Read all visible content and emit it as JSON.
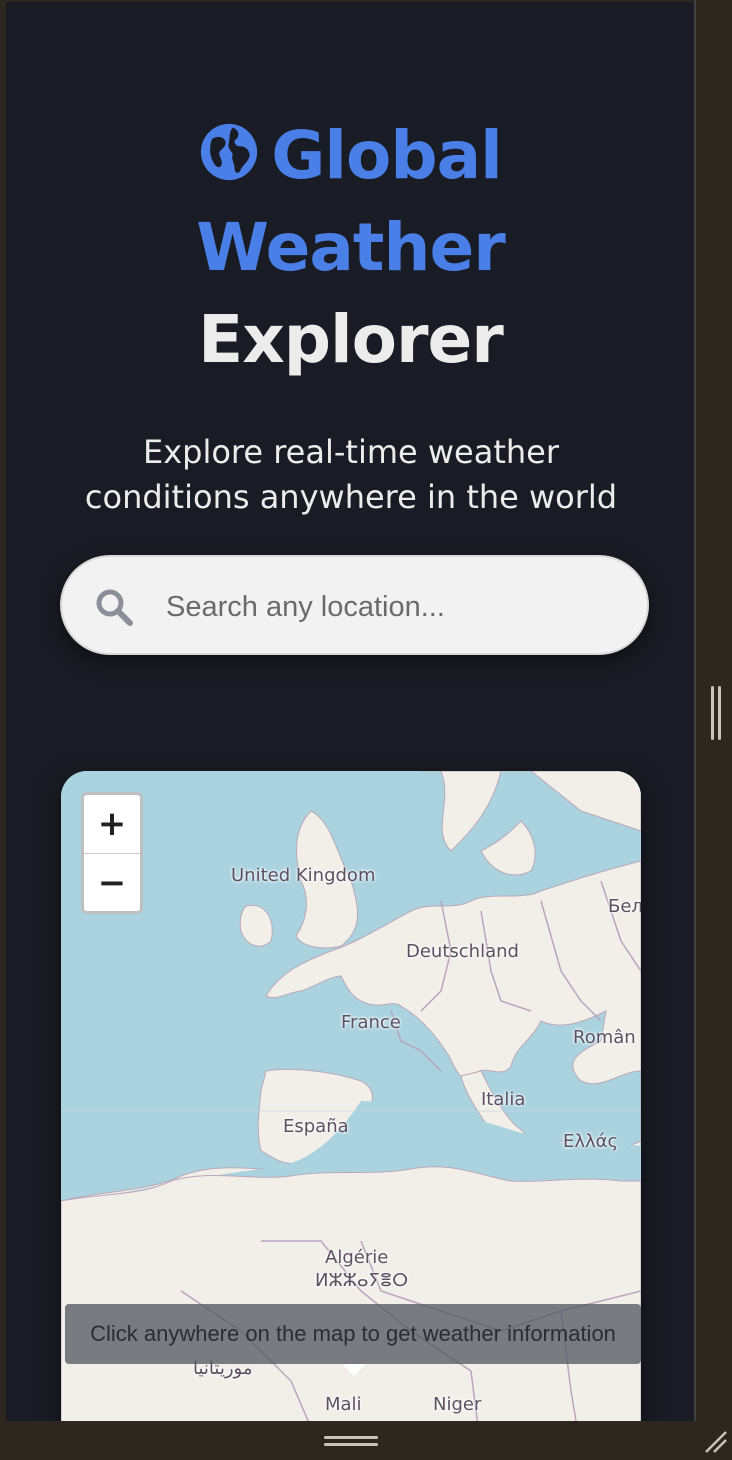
{
  "header": {
    "title_line1": "Global",
    "title_line2": "Weather",
    "title_line3": "Explorer",
    "icon": "globe-icon",
    "subtitle": "Explore real-time weather conditions anywhere in the world"
  },
  "search": {
    "placeholder": "Search any location...",
    "value": "",
    "icon": "search-icon"
  },
  "map": {
    "zoom_in_label": "+",
    "zoom_out_label": "−",
    "labels": {
      "uk": "United Kingdom",
      "de": "Deutschland",
      "fr": "France",
      "ro": "Român",
      "es": "España",
      "it": "Italia",
      "gr": "Ελλάς",
      "by": "Бел",
      "dz": "Algérie",
      "dz_tifinagh": "ⵍⵣⵣⴰⵢⴻⵔ",
      "ml": "Mali",
      "ne": "Niger",
      "mr": "موريتانيا"
    },
    "tooltip": "Click anywhere on the map to get weather information"
  },
  "colors": {
    "background": "#191c24",
    "accent": "#4a7fe8",
    "text": "#ececec",
    "sea": "#aad3df",
    "land": "#f2efe9"
  }
}
